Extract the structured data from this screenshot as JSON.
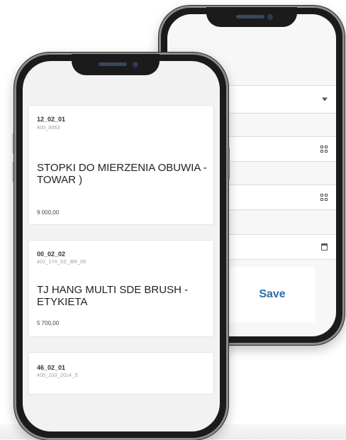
{
  "back_screen": {
    "save_label": "Save"
  },
  "front_screen": {
    "items": [
      {
        "code": "12_02_01",
        "sub": "400_0063",
        "name": "STOPKI DO MIERZENIA OBUWIA - TOWAR )",
        "qty": "9 000,00"
      },
      {
        "code": "00_02_02",
        "sub": "401_174_SC_BR_05",
        "name": "TJ HANG MULTI SDE BRUSH - ETYKIETA",
        "qty": "5 700,00"
      },
      {
        "code": "46_02_01",
        "sub": "400_103_2014_S"
      }
    ]
  }
}
